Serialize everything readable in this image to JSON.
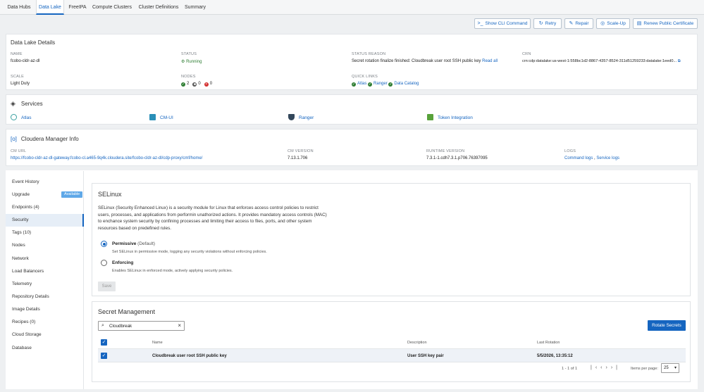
{
  "nav": {
    "tabs": [
      {
        "label": "Data Hubs"
      },
      {
        "label": "Data Lake"
      },
      {
        "label": "FreeIPA"
      },
      {
        "label": "Compute Clusters"
      },
      {
        "label": "Cluster Definitions"
      },
      {
        "label": "Summary"
      }
    ],
    "active_index": 1
  },
  "actions": {
    "show_cli": "Show CLI Command",
    "retry": "Retry",
    "repair": "Repair",
    "scale_up": "Scale-Up",
    "renew_cert": "Renew Public Certificate"
  },
  "details": {
    "title": "Data Lake Details",
    "name_label": "NAME",
    "name_value": "fcobo-cldr-az-dl",
    "status_label": "STATUS",
    "status_value": "Running",
    "reason_label": "STATUS REASON",
    "reason_value": "Secret rotation finalize finished: Cloudbreak user root SSH public key",
    "reason_link": "Read all",
    "crn_label": "CRN",
    "crn_value": "crn:cdp:datalake:us-west-1:558bc1d2-8867-4357-8524-311d51259233:datalake:1eed0...",
    "scale_label": "SCALE",
    "scale_value": "Light Duty",
    "nodes_label": "NODES",
    "nodes_ok": "2",
    "nodes_stopped": "0",
    "nodes_failed": "0",
    "quick_label": "QUICK LINKS",
    "quick_links": [
      "Atlas",
      "Ranger",
      "Data Catalog"
    ]
  },
  "services": {
    "title": "Services",
    "items": [
      {
        "label": "Atlas"
      },
      {
        "label": "CM-UI"
      },
      {
        "label": "Ranger"
      },
      {
        "label": "Token Integration"
      }
    ]
  },
  "cm": {
    "title": "Cloudera Manager Info",
    "url_label": "CM URL",
    "url_value": "https://fcobo-cldr-az-dl-gateway.fcobo-cl.a465-9q4k.cloudera.site/fcobo-cldr-az-dl/cdp-proxy/cmf/home/",
    "version_label": "CM VERSION",
    "version_value": "7.13.1.706",
    "runtime_label": "RUNTIME VERSION",
    "runtime_value": "7.3.1-1.cdh7.3.1.p706.76397095",
    "logs_label": "LOGS",
    "logs_command": "Command logs",
    "logs_sep": ",",
    "logs_service": "Service logs"
  },
  "sidebar": {
    "items": [
      {
        "label": "Event History"
      },
      {
        "label": "Upgrade"
      },
      {
        "label": "Endpoints (4)"
      },
      {
        "label": "Security"
      },
      {
        "label": "Tags (10)"
      },
      {
        "label": "Nodes"
      },
      {
        "label": "Network"
      },
      {
        "label": "Load Balancers"
      },
      {
        "label": "Telemetry"
      },
      {
        "label": "Repository Details"
      },
      {
        "label": "Image Details"
      },
      {
        "label": "Recipes (0)"
      },
      {
        "label": "Cloud Storage"
      },
      {
        "label": "Database"
      }
    ],
    "upgrade_badge": "Available",
    "active_index": 3
  },
  "selinux": {
    "title": "SELinux",
    "description": "SELinux (Security Enhanced Linux) is a security module for Linux that enforces access control policies to restrict users, processes, and applications from performin unathorized actions. It provides mandatory access controls (MAC) to enchance system security by confining processes and limiting their access to files, ports, and other system resources based on predefined rules.",
    "permissive_label": "Permissive",
    "permissive_default": "(Default)",
    "permissive_desc": "Set SELinux in permissive mode, logging any security violations without enforcing policies.",
    "enforcing_label": "Enforcing",
    "enforcing_desc": "Enables SELinux in enforced mode, actively applying security policies.",
    "save_label": "Save",
    "selected": "permissive"
  },
  "secrets": {
    "title": "Secret Management",
    "search_value": "Cloudbreak",
    "rotate_label": "Rotate Secrets",
    "columns": [
      "Name",
      "Description",
      "Last Rotation"
    ],
    "rows": [
      {
        "name": "Cloudbreak user root SSH public key",
        "description": "User SSH key pair",
        "last_rotation": "5/5/2026, 13:35:12"
      }
    ],
    "pagination": "1 - 1 of 1",
    "items_per_page_label": "Items per page:",
    "items_per_page": "25"
  },
  "colors": {
    "accent": "#1565c0",
    "success": "#2e7d32",
    "danger": "#d32f2f",
    "badge": "#5fa8e8"
  }
}
